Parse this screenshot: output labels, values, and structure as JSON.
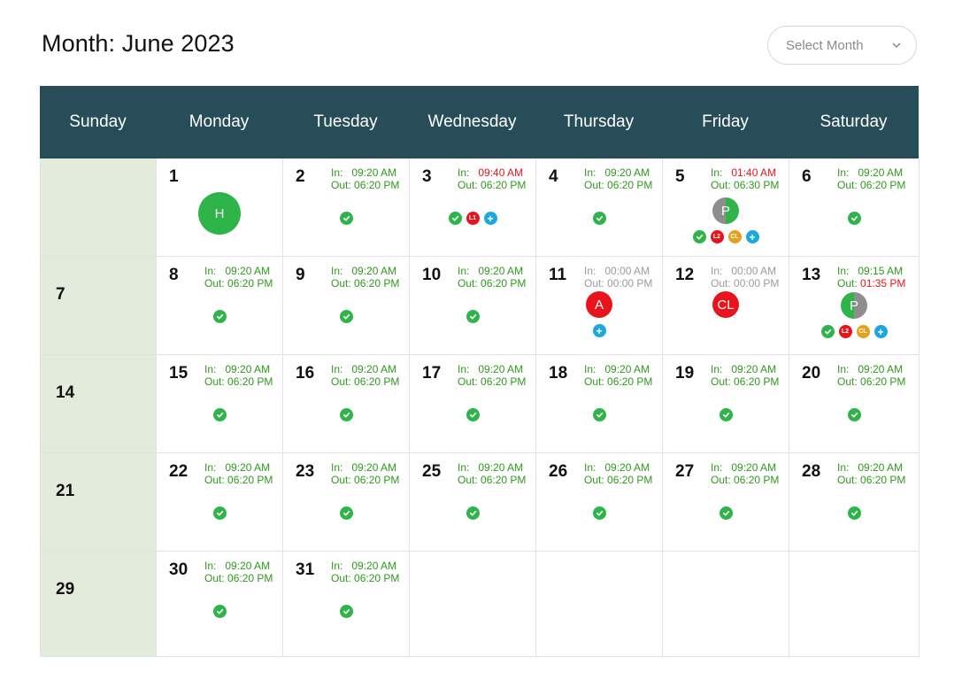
{
  "page": {
    "title": "Month: June 2023",
    "select_placeholder": "Select Month"
  },
  "colors": {
    "header_bg": "#264d58",
    "sunday_bg": "#e3ecdc",
    "green": "#2e9a1c",
    "red": "#e8131b",
    "holiday": "#2fb44a",
    "absent": "#e8131b",
    "partial": "#8e8e8e",
    "cl": "#e3a21b",
    "plus": "#1ba8e0"
  },
  "labels": {
    "in": "In:",
    "out": "Out:"
  },
  "weekdays": [
    "Sunday",
    "Monday",
    "Tuesday",
    "Wednesday",
    "Thursday",
    "Friday",
    "Saturday"
  ],
  "days": [
    {
      "day": null
    },
    {
      "day": "1",
      "badge": {
        "text": "H",
        "type": "holiday"
      }
    },
    {
      "day": "2",
      "in": "09:20 AM",
      "out": "06:20 PM",
      "icons": [
        "check"
      ]
    },
    {
      "day": "3",
      "in": "09:40 AM",
      "in_late": true,
      "out": "06:20 PM",
      "icons": [
        "check",
        "L1",
        "plus"
      ]
    },
    {
      "day": "4",
      "in": "09:20 AM",
      "out": "06:20 PM",
      "icons": [
        "check"
      ]
    },
    {
      "day": "5",
      "in": "01:40 AM",
      "in_late": true,
      "out": "06:30 PM",
      "badge": {
        "text": "P",
        "type": "partial"
      },
      "icons": [
        "check",
        "L2",
        "CL",
        "plus"
      ]
    },
    {
      "day": "6",
      "in": "09:20 AM",
      "out": "06:20 PM",
      "icons": [
        "check"
      ]
    },
    {
      "day": "7"
    },
    {
      "day": "8",
      "in": "09:20 AM",
      "out": "06:20 PM",
      "icons": [
        "check"
      ]
    },
    {
      "day": "9",
      "in": "09:20 AM",
      "out": "06:20 PM",
      "icons": [
        "check"
      ]
    },
    {
      "day": "10",
      "in": "09:20 AM",
      "out": "06:20 PM",
      "icons": [
        "check"
      ]
    },
    {
      "day": "11",
      "in": "00:00 AM",
      "out": "00:00 PM",
      "muted": true,
      "badge": {
        "text": "A",
        "type": "absent"
      },
      "icons": [
        "plus"
      ]
    },
    {
      "day": "12",
      "in": "00:00 AM",
      "out": "00:00 PM",
      "muted": true,
      "badge": {
        "text": "CL",
        "type": "absent"
      }
    },
    {
      "day": "13",
      "in": "09:15 AM",
      "out": "01:35 PM",
      "out_late": true,
      "badge": {
        "text": "P",
        "type": "partial-green"
      },
      "icons": [
        "check",
        "L2",
        "CL",
        "plus"
      ]
    },
    {
      "day": "14"
    },
    {
      "day": "15",
      "in": "09:20 AM",
      "out": "06:20 PM",
      "icons": [
        "check"
      ]
    },
    {
      "day": "16",
      "in": "09:20 AM",
      "out": "06:20 PM",
      "icons": [
        "check"
      ]
    },
    {
      "day": "17",
      "in": "09:20 AM",
      "out": "06:20 PM",
      "icons": [
        "check"
      ]
    },
    {
      "day": "18",
      "in": "09:20 AM",
      "out": "06:20 PM",
      "icons": [
        "check"
      ]
    },
    {
      "day": "19",
      "in": "09:20 AM",
      "out": "06:20 PM",
      "icons": [
        "check"
      ]
    },
    {
      "day": "20",
      "in": "09:20 AM",
      "out": "06:20 PM",
      "icons": [
        "check"
      ]
    },
    {
      "day": "21"
    },
    {
      "day": "22",
      "in": "09:20 AM",
      "out": "06:20 PM",
      "icons": [
        "check"
      ]
    },
    {
      "day": "23",
      "in": "09:20 AM",
      "out": "06:20 PM",
      "icons": [
        "check"
      ]
    },
    {
      "day": "25",
      "in": "09:20 AM",
      "out": "06:20 PM",
      "icons": [
        "check"
      ]
    },
    {
      "day": "26",
      "in": "09:20 AM",
      "out": "06:20 PM",
      "icons": [
        "check"
      ]
    },
    {
      "day": "27",
      "in": "09:20 AM",
      "out": "06:20 PM",
      "icons": [
        "check"
      ]
    },
    {
      "day": "28",
      "in": "09:20 AM",
      "out": "06:20 PM",
      "icons": [
        "check"
      ]
    },
    {
      "day": "29"
    },
    {
      "day": "30",
      "in": "09:20 AM",
      "out": "06:20 PM",
      "icons": [
        "check"
      ]
    },
    {
      "day": "31",
      "in": "09:20 AM",
      "out": "06:20 PM",
      "icons": [
        "check"
      ]
    },
    {
      "day": null
    },
    {
      "day": null
    },
    {
      "day": null
    },
    {
      "day": null
    }
  ]
}
